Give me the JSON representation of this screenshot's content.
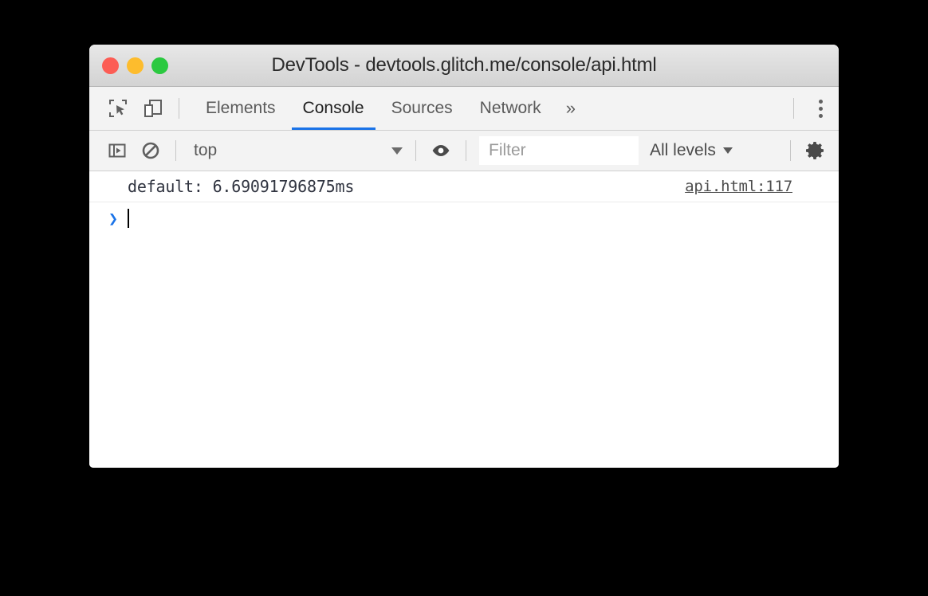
{
  "window": {
    "title": "DevTools - devtools.glitch.me/console/api.html",
    "traffic_lights": [
      {
        "name": "close",
        "color": "#fc5d55"
      },
      {
        "name": "minimize",
        "color": "#fdbc2d"
      },
      {
        "name": "maximize",
        "color": "#2bc940"
      }
    ]
  },
  "tabbar": {
    "inspect_icon": "inspect-element-icon",
    "device_icon": "device-toolbar-icon",
    "tabs": [
      {
        "label": "Elements",
        "active": false
      },
      {
        "label": "Console",
        "active": true
      },
      {
        "label": "Sources",
        "active": false
      },
      {
        "label": "Network",
        "active": false
      }
    ],
    "overflow_label": "»",
    "menu_icon": "kebab-menu-icon",
    "active_underline_color": "#1a73e8"
  },
  "console_toolbar": {
    "sidebar_icon": "console-sidebar-icon",
    "clear_icon": "clear-console-icon",
    "context": {
      "value": "top",
      "caret": "▼"
    },
    "eye_icon": "live-expression-eye-icon",
    "filter": {
      "placeholder": "Filter",
      "value": ""
    },
    "levels": {
      "label": "All levels",
      "caret": "▼"
    },
    "settings_icon": "settings-gear-icon"
  },
  "console": {
    "messages": [
      {
        "text": "default: 6.69091796875ms",
        "source": "api.html:117"
      }
    ],
    "prompt": {
      "chevron": "❯",
      "input_value": ""
    }
  }
}
